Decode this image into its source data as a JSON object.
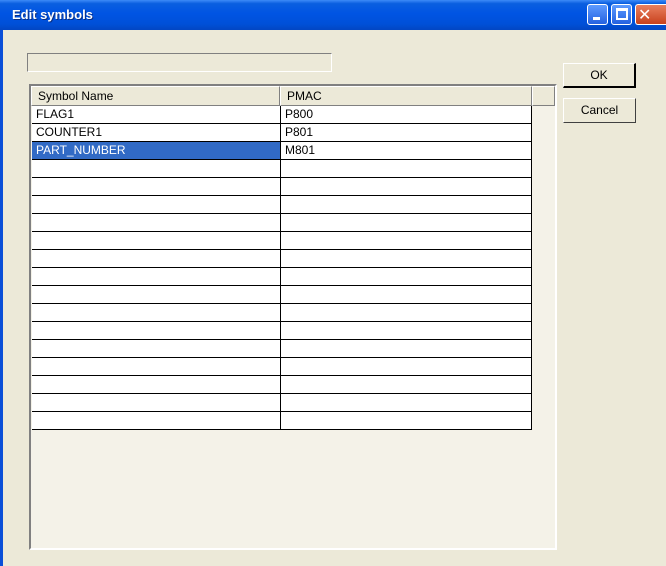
{
  "window": {
    "title": "Edit symbols",
    "accent_color": "#0054e3",
    "selection_color": "#316ac5",
    "status_text": ""
  },
  "buttons": {
    "ok_label": "OK",
    "cancel_label": "Cancel"
  },
  "table": {
    "columns": [
      "Symbol Name",
      "PMAC"
    ],
    "selected_row": 2,
    "rows": [
      {
        "name": "FLAG1",
        "pmac": "P800"
      },
      {
        "name": "COUNTER1",
        "pmac": "P801"
      },
      {
        "name": "PART_NUMBER",
        "pmac": "M801"
      },
      {
        "name": "",
        "pmac": ""
      },
      {
        "name": "",
        "pmac": ""
      },
      {
        "name": "",
        "pmac": ""
      },
      {
        "name": "",
        "pmac": ""
      },
      {
        "name": "",
        "pmac": ""
      },
      {
        "name": "",
        "pmac": ""
      },
      {
        "name": "",
        "pmac": ""
      },
      {
        "name": "",
        "pmac": ""
      },
      {
        "name": "",
        "pmac": ""
      },
      {
        "name": "",
        "pmac": ""
      },
      {
        "name": "",
        "pmac": ""
      },
      {
        "name": "",
        "pmac": ""
      },
      {
        "name": "",
        "pmac": ""
      },
      {
        "name": "",
        "pmac": ""
      },
      {
        "name": "",
        "pmac": ""
      }
    ]
  }
}
